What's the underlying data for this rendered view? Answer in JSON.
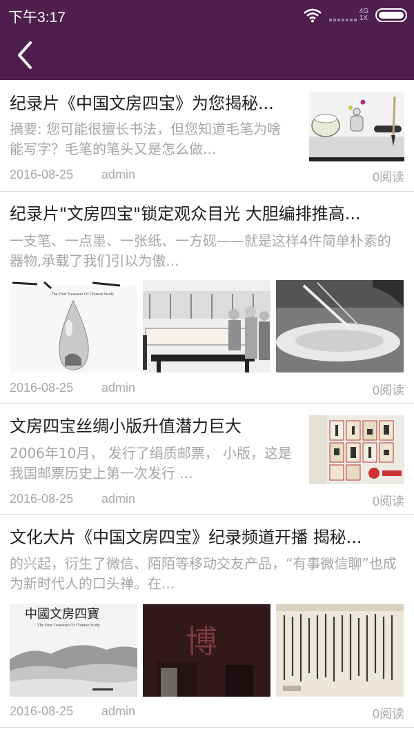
{
  "status": {
    "time": "下午3:17",
    "network_top": "4G",
    "network_bottom": "1X"
  },
  "appbar": {
    "back_icon": "chevron-left-icon",
    "color": "#4e1e4f"
  },
  "articles": [
    {
      "title": "纪录片《中国文房四宝》为您揭秘...",
      "summary": "摘要: 您可能很擅长书法，但您知道毛笔为啥能写字？毛笔的笔头又是怎么做...",
      "date": "2016-08-25",
      "author": "admin",
      "reads": "0阅读"
    },
    {
      "title": "纪录片\"文房四宝\"锁定观众目光 大胆编排推高...",
      "summary": "一支笔、一点墨、一张纸、一方砚——就是这样4件简单朴素的器物,承载了我们引以为傲...",
      "date": "2016-08-25",
      "author": "admin",
      "reads": "0阅读",
      "image_text": "The Four Treasures Of Chinese Study"
    },
    {
      "title": "文房四宝丝绸小版升值潜力巨大",
      "summary": "2006年10月， 发行了绢质邮票， 小版，这是我国邮票历史上第一次发行 ...",
      "date": "2016-08-25",
      "author": "admin",
      "reads": "0阅读"
    },
    {
      "title": "文化大片《中国文房四宝》纪录频道开播  揭秘...",
      "summary": "的兴起，衍生了微信、陌陌等移动交友产品，“有事微信聊”也成为新时代人的口头禅。在...",
      "date": "2016-08-25",
      "author": "admin",
      "reads": "0阅读",
      "image_title": "中國文房四寶",
      "image_text": "The Four Treasures Of Chinese Study",
      "image_char": "博"
    }
  ]
}
